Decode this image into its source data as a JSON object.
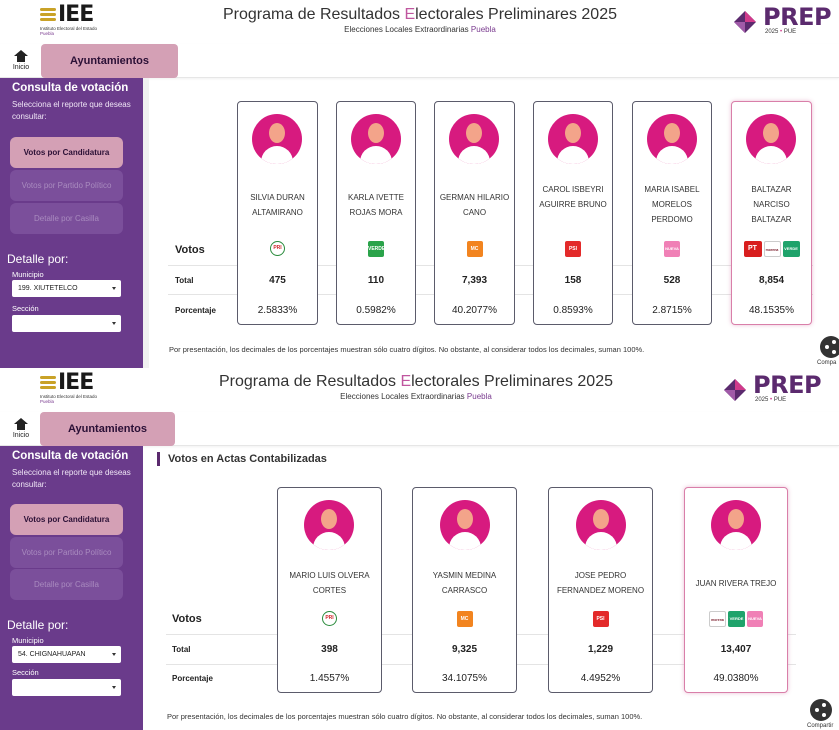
{
  "header": {
    "logo_text": "IEE",
    "logo_sub": "Instituto Electoral del Estado",
    "logo_state": "Puebla",
    "title_before": "Programa de Resultados ",
    "title_e": "E",
    "title_after": "lectorales Preliminares 2025",
    "subtitle": "Elecciones Locales Extraordinarias ",
    "subtitle_place": "Puebla",
    "prep_text": "PREP",
    "prep_year": "2025",
    "prep_bullet": "•",
    "prep_state": "PUE"
  },
  "nav": {
    "home_label": "Inicio",
    "tab_label": "Ayuntamientos"
  },
  "sidebar": {
    "title": "Consulta de votación",
    "instructions": "Selecciona el reporte que deseas consultar:",
    "btn_candidatura": "Votos por Candidatura",
    "btn_partido": "Votos por Partido Político",
    "btn_casilla": "Detalle por Casilla",
    "detalle_title": "Detalle por:",
    "municipio_label": "Municipio",
    "seccion_label": "Sección"
  },
  "labels": {
    "votos": "Votos",
    "total": "Total",
    "porcentaje": "Porcentaje",
    "note": "Por presentación, los decimales de los porcentajes muestran sólo cuatro dígitos. No obstante, al considerar todos los decimales, suman 100%.",
    "share_label": "Compartir",
    "share_label_cut": "Compa",
    "section_title": "Votos en Actas Contabilizadas"
  },
  "parties": {
    "pri": "PRI",
    "verde": "VERDE",
    "mc": "MC",
    "psi": "PSI",
    "npp": "NUEVA PUEBLA",
    "pt": "PT",
    "morena": "morena",
    "pvem": "VERDE"
  },
  "view_a": {
    "municipio": "199. XIUTETELCO",
    "seccion": "",
    "candidates": [
      {
        "name": "SILVIA DURAN ALTAMIRANO",
        "total": "475",
        "pct": "2.5833%"
      },
      {
        "name": "KARLA IVETTE ROJAS MORA",
        "total": "110",
        "pct": "0.5982%"
      },
      {
        "name": "GERMAN HILARIO CANO",
        "total": "7,393",
        "pct": "40.2077%"
      },
      {
        "name": "CAROL ISBEYRI AGUIRRE BRUNO",
        "total": "158",
        "pct": "0.8593%"
      },
      {
        "name": "MARIA ISABEL MORELOS PERDOMO",
        "total": "528",
        "pct": "2.8715%"
      },
      {
        "name": "BALTAZAR NARCISO BALTAZAR",
        "total": "8,854",
        "pct": "48.1535%"
      }
    ]
  },
  "view_b": {
    "municipio": "54. CHIGNAHUAPAN",
    "seccion": "",
    "candidates": [
      {
        "name": "MARIO LUIS OLVERA CORTES",
        "total": "398",
        "pct": "1.4557%"
      },
      {
        "name": "YASMIN MEDINA CARRASCO",
        "total": "9,325",
        "pct": "34.1075%"
      },
      {
        "name": "JOSE PEDRO FERNANDEZ MORENO",
        "total": "1,229",
        "pct": "4.4952%"
      },
      {
        "name": "JUAN RIVERA TREJO",
        "total": "13,407",
        "pct": "49.0380%"
      }
    ]
  },
  "colors": {
    "purple": "#6a3b8b",
    "pink": "#d4a0b5",
    "magenta": "#d71a7f",
    "winner_border": "#d97fa9"
  }
}
